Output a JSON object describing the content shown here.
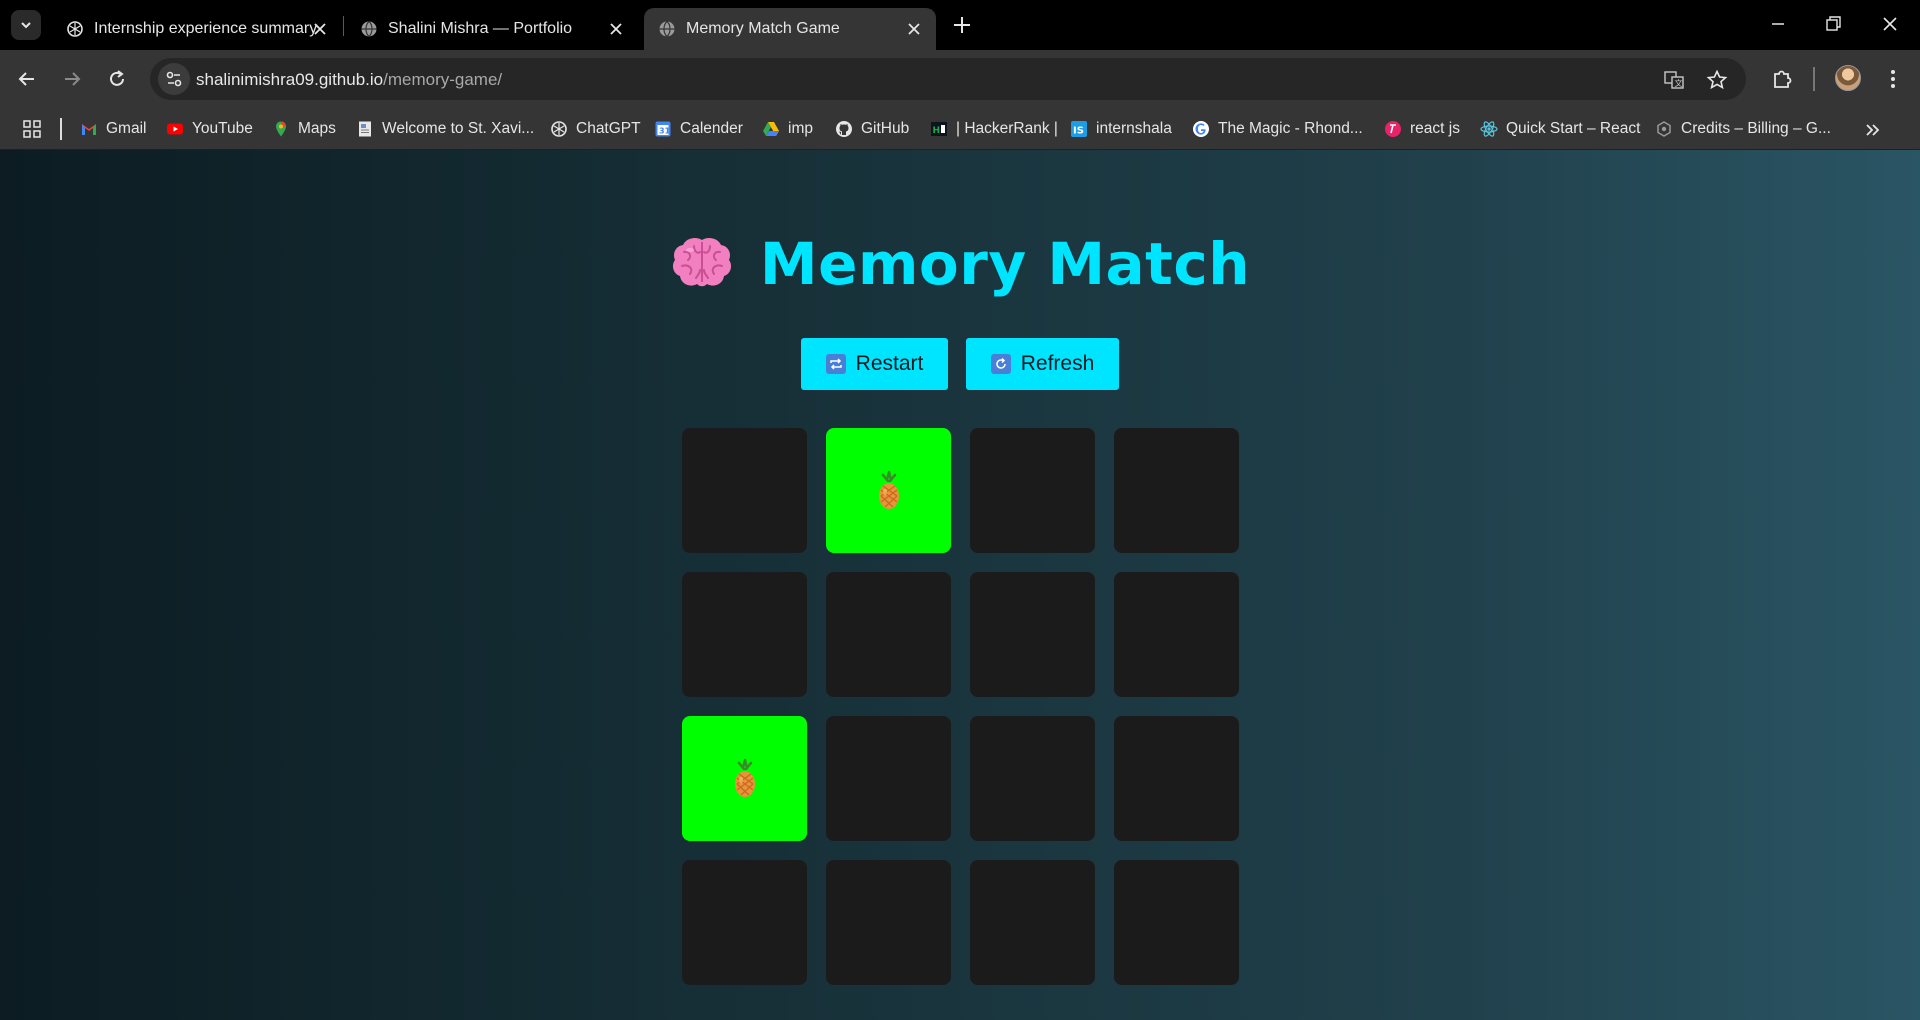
{
  "browser": {
    "tabs": [
      {
        "title": "Internship experience summary",
        "favicon": "chatgpt-icon",
        "active": false
      },
      {
        "title": "Shalini Mishra — Portfolio",
        "favicon": "globe-icon",
        "active": false
      },
      {
        "title": "Memory Match Game",
        "favicon": "globe-icon",
        "active": true
      }
    ],
    "url": {
      "host": "shalinimishra09.github.io",
      "path": "/memory-game/"
    },
    "bookmarks": [
      {
        "label": "Gmail",
        "icon": "gmail-icon"
      },
      {
        "label": "YouTube",
        "icon": "youtube-icon"
      },
      {
        "label": "Maps",
        "icon": "maps-icon"
      },
      {
        "label": "Welcome to St. Xavi...",
        "icon": "document-icon"
      },
      {
        "label": "ChatGPT",
        "icon": "chatgpt-icon"
      },
      {
        "label": "Calender",
        "icon": "calendar-icon"
      },
      {
        "label": "imp",
        "icon": "drive-icon"
      },
      {
        "label": "GitHub",
        "icon": "github-icon"
      },
      {
        "label": "| HackerRank |",
        "icon": "hackerrank-icon"
      },
      {
        "label": "internshala",
        "icon": "internshala-icon"
      },
      {
        "label": "The Magic - Rhond...",
        "icon": "google-icon"
      },
      {
        "label": "react js",
        "icon": "react-js-icon"
      },
      {
        "label": "Quick Start – React",
        "icon": "react-icon"
      },
      {
        "label": "Credits – Billing – G...",
        "icon": "cloud-icon"
      }
    ]
  },
  "game": {
    "title": "Memory Match",
    "title_icon": "brain-icon",
    "accent_color": "#00e5ff",
    "matched_color": "#00ff00",
    "buttons": {
      "restart_label": "Restart",
      "refresh_label": "Refresh"
    },
    "grid": {
      "rows": 4,
      "cols": 4
    },
    "revealed_cards": [
      {
        "row": 1,
        "col": 2,
        "content": "pineapple-icon"
      },
      {
        "row": 3,
        "col": 1,
        "content": "pineapple-icon"
      }
    ]
  }
}
